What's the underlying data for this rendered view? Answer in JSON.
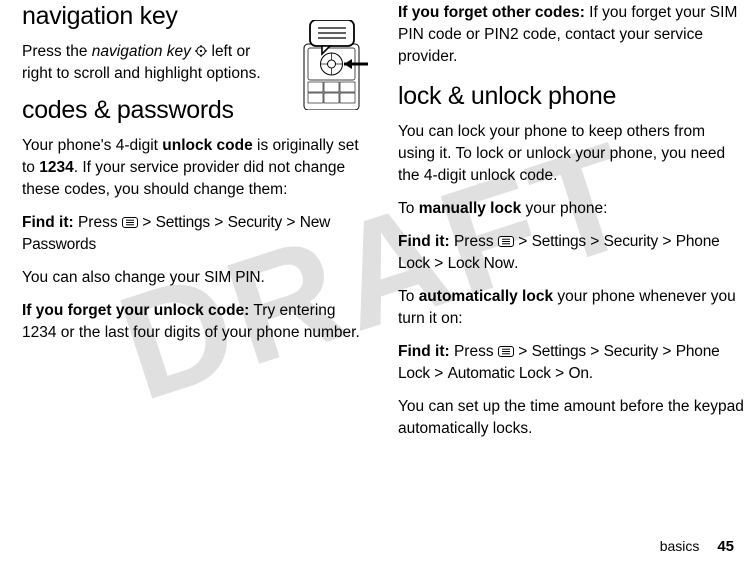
{
  "watermark": "DRAFT",
  "left": {
    "h_nav": "navigation key",
    "nav_p_before": "Press the ",
    "nav_p_italic": "navigation key ",
    "nav_p_after1": " left or right to scroll and highlight options.",
    "h_codes": "codes & passwords",
    "codes_p1_a": "Your phone's 4-digit ",
    "codes_p1_b": "unlock code",
    "codes_p1_c": " is originally set to ",
    "codes_p1_d": "1234",
    "codes_p1_e": ". If your service provider did not change these codes, you should change them:",
    "find1_a": "Find it:",
    "find1_b": " Press ",
    "find1_c": " > ",
    "find1_settings": "Settings",
    "find1_security": "Security",
    "find1_newpw": "New Passwords",
    "simpin_a": "You can also change your ",
    "simpin_b": "SIM PIN",
    "simpin_c": ".",
    "forget1_a": "If you forget your unlock code:",
    "forget1_b": " Try entering 1234 or the last four digits of your phone number."
  },
  "right": {
    "forget2_a": "If you forget other codes:",
    "forget2_b": " If you forget your SIM PIN code or PIN2 code, contact your service provider.",
    "h_lock": "lock & unlock phone",
    "lock_p1": "You can lock your phone to keep others from using it. To lock or unlock your phone, you need the 4-digit unlock code.",
    "manlock_a": "To ",
    "manlock_b": "manually lock",
    "manlock_c": " your phone:",
    "find2_a": "Find it:",
    "find2_b": " Press ",
    "find2_sep": " > ",
    "find2_settings": "Settings",
    "find2_security": "Security",
    "find2_phonelock": "Phone Lock",
    "find2_locknow": "Lock Now",
    "find2_dot": ".",
    "autolock_a": "To ",
    "autolock_b": "automatically lock",
    "autolock_c": " your phone whenever you turn it on:",
    "find3_a": "Find it:",
    "find3_b": " Press ",
    "find3_sep": " > ",
    "find3_settings": "Settings",
    "find3_security": "Security",
    "find3_phonelock": "Phone Lock",
    "find3_autolock": "Automatic Lock",
    "find3_on": "On",
    "find3_dot": ".",
    "last_p": "You can set up the time amount before the keypad automatically locks."
  },
  "footer": {
    "label": "basics",
    "page": "45"
  }
}
